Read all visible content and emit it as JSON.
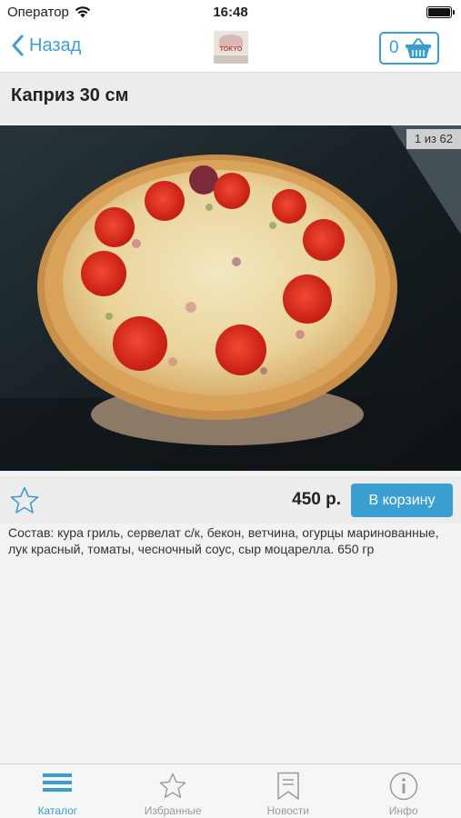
{
  "status_bar": {
    "carrier": "Оператор",
    "time": "16:48"
  },
  "nav": {
    "back_label": "Назад",
    "cart_count": "0"
  },
  "product": {
    "title": "Каприз 30 см",
    "photo_counter": "1 из 62",
    "price": "450 р.",
    "add_to_cart_label": "В корзину",
    "description": "Состав: кура гриль, сервелат с/к, бекон, ветчина, огурцы маринованные, лук красный, томаты, чесночный соус, сыр моцарелла. 650 гр"
  },
  "tabs": [
    {
      "label": "Каталог",
      "icon": "menu-icon",
      "active": true
    },
    {
      "label": "Избранные",
      "icon": "star-icon",
      "active": false
    },
    {
      "label": "Новости",
      "icon": "bookmark-icon",
      "active": false
    },
    {
      "label": "Инфо",
      "icon": "info-icon",
      "active": false
    }
  ],
  "colors": {
    "accent": "#3a9fd0",
    "tab_inactive": "#9a9a9a",
    "background": "#f2f2f2"
  }
}
